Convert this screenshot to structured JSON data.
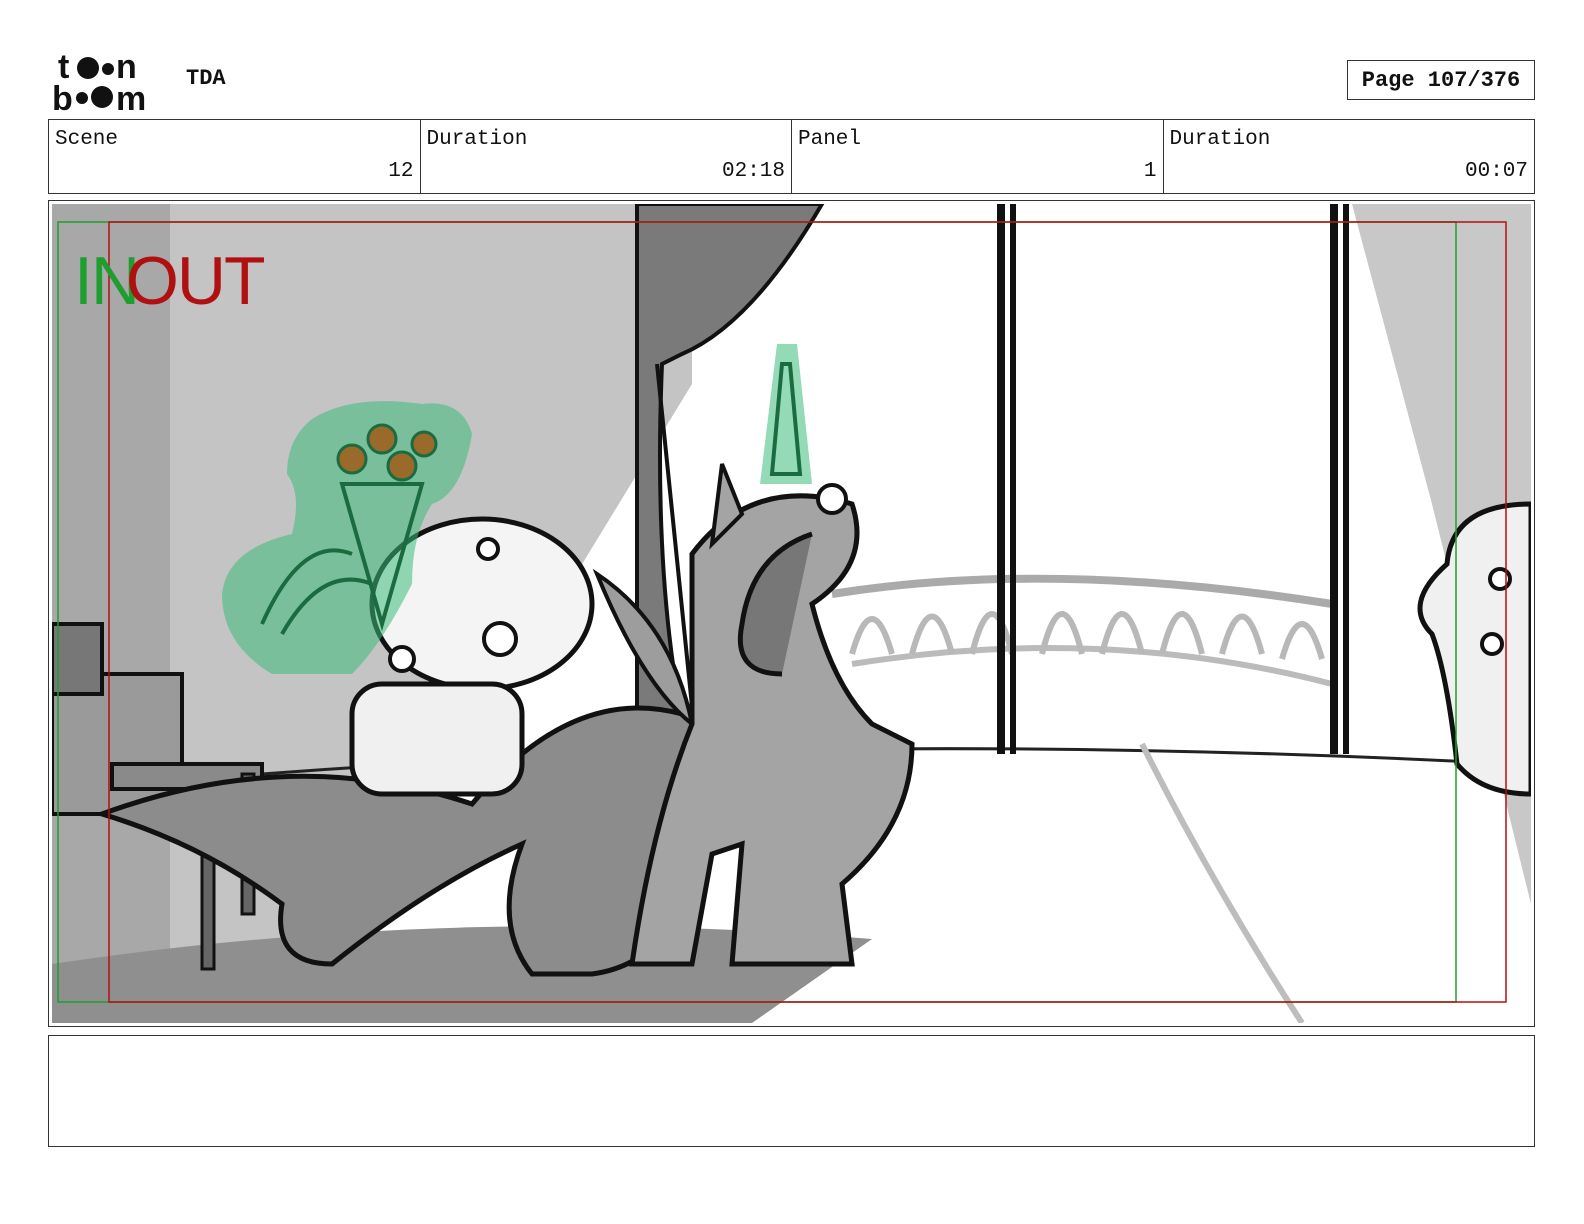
{
  "header": {
    "logo_text": "toon boom",
    "project": "TDA",
    "page_label": "Page 107/376"
  },
  "info": {
    "scene_label": "Scene",
    "scene_value": "12",
    "scene_duration_label": "Duration",
    "scene_duration_value": "02:18",
    "panel_label": "Panel",
    "panel_value": "1",
    "panel_duration_label": "Duration",
    "panel_duration_value": "00:07"
  },
  "panel": {
    "in_label": "IN",
    "out_label": "OUT",
    "colors": {
      "in_frame": "#1e9e2e",
      "out_frame": "#b01010",
      "fx_green": "#3dbb7a",
      "shade": "#bdbdbd"
    }
  },
  "notes": {
    "text": ""
  }
}
